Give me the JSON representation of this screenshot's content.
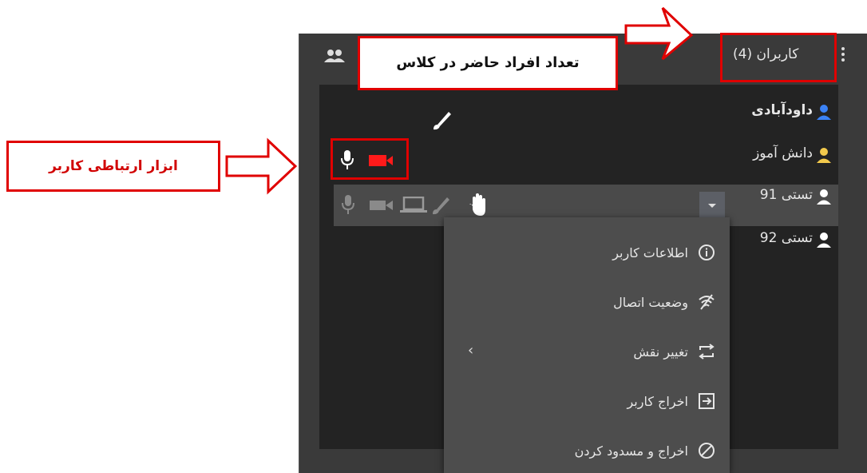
{
  "panel": {
    "users_title": "کاربران (4)"
  },
  "annotations": {
    "class_count": "تعداد افراد حاضر در کلاس",
    "user_tools": "ابزار ارتباطی کاربر"
  },
  "users": [
    {
      "name": "داودآبادی",
      "role": "presenter",
      "icon_color": "#3b82f6"
    },
    {
      "name": "دانش آموز",
      "role": "student",
      "icon_color": "#f2c94c"
    },
    {
      "name": "تستی 91",
      "role": "guest",
      "icon_color": "#ffffff"
    },
    {
      "name": "تستی 92",
      "role": "guest",
      "icon_color": "#ffffff"
    }
  ],
  "context_menu": {
    "items": [
      {
        "label": "اطلاعات کاربر",
        "icon": "info-icon"
      },
      {
        "label": "وضعیت اتصال",
        "icon": "connection-status-icon"
      },
      {
        "label": "تغییر نقش",
        "icon": "swap-role-icon",
        "has_submenu": true
      },
      {
        "label": "اخراج کاربر",
        "icon": "kick-icon"
      },
      {
        "label": "اخراج و مسدود کردن",
        "icon": "ban-icon"
      }
    ],
    "submenu_arrow": "‹"
  },
  "colors": {
    "highlight_red": "#e00000",
    "camera_active": "#ff1a1a",
    "panel_bg": "#3a3a3a"
  }
}
